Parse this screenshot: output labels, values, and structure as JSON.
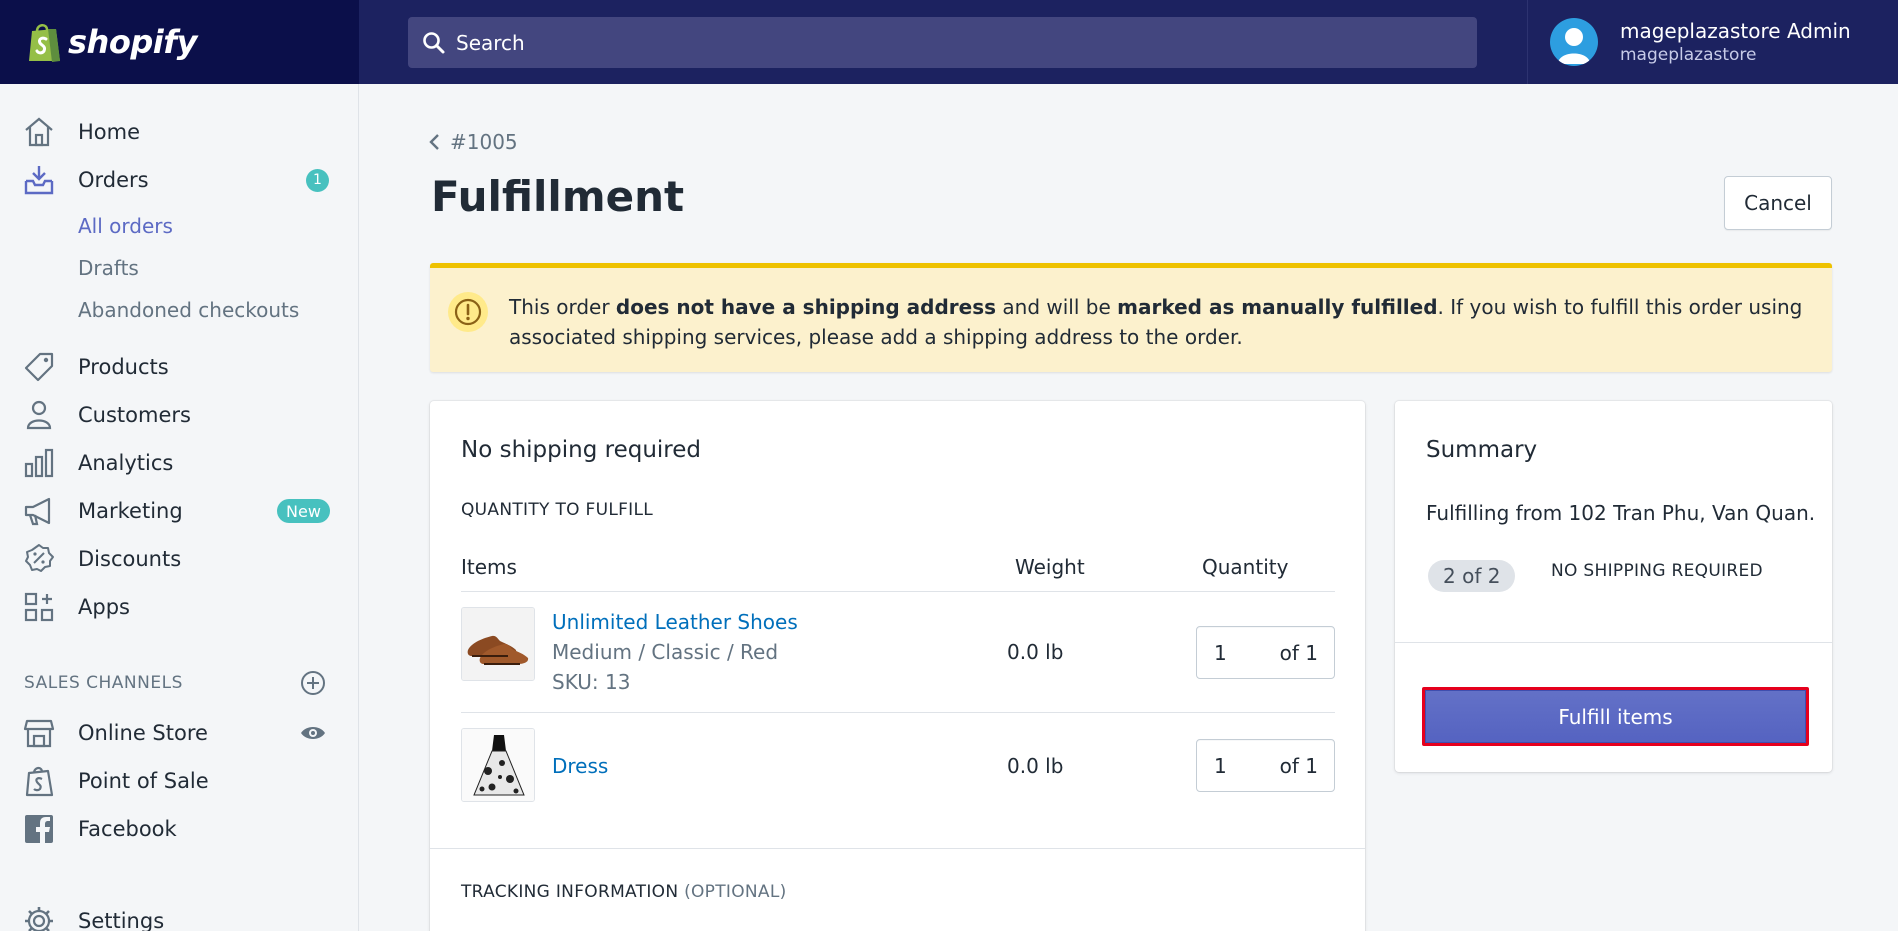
{
  "brand": {
    "name": "shopify"
  },
  "search": {
    "placeholder": "Search"
  },
  "user": {
    "name": "mageplazastore Admin",
    "store": "mageplazastore"
  },
  "sidebar": {
    "items": [
      {
        "label": "Home",
        "icon": "home-icon"
      },
      {
        "label": "Orders",
        "icon": "orders-icon",
        "badge": "1"
      },
      {
        "label": "Products",
        "icon": "tag-icon"
      },
      {
        "label": "Customers",
        "icon": "person-icon"
      },
      {
        "label": "Analytics",
        "icon": "bar-chart-icon"
      },
      {
        "label": "Marketing",
        "icon": "megaphone-icon",
        "badge": "New"
      },
      {
        "label": "Discounts",
        "icon": "discount-icon"
      },
      {
        "label": "Apps",
        "icon": "apps-icon"
      }
    ],
    "orders_sub": [
      "All orders",
      "Drafts",
      "Abandoned checkouts"
    ],
    "sales_channels_heading": "SALES CHANNELS",
    "channels": [
      {
        "label": "Online Store",
        "icon": "store-icon"
      },
      {
        "label": "Point of Sale",
        "icon": "pos-bag-icon"
      },
      {
        "label": "Facebook",
        "icon": "facebook-icon"
      }
    ],
    "settings": {
      "label": "Settings",
      "icon": "gear-icon"
    }
  },
  "page": {
    "back_label": "#1005",
    "title": "Fulfillment",
    "cancel_label": "Cancel"
  },
  "banner": {
    "t1": "This order ",
    "b1": "does not have a shipping address",
    "t2": " and will be ",
    "b2": "marked as manually fulfilled",
    "t3": ". If you wish to fulfill this order using associated shipping services, please add a shipping address to the order."
  },
  "fulfill_card": {
    "title": "No shipping required",
    "quantity_heading": "QUANTITY TO FULFILL",
    "columns": {
      "items": "Items",
      "weight": "Weight",
      "quantity": "Quantity"
    },
    "rows": [
      {
        "name": "Unlimited Leather Shoes",
        "variant": "Medium / Classic / Red",
        "sku": "SKU: 13",
        "weight": "0.0 lb",
        "qty": "1",
        "of": "of 1"
      },
      {
        "name": "Dress",
        "weight": "0.0 lb",
        "qty": "1",
        "of": "of 1"
      }
    ],
    "tracking_heading": "TRACKING INFORMATION",
    "tracking_optional": "(OPTIONAL)"
  },
  "summary": {
    "title": "Summary",
    "from_text": "Fulfilling from 102 Tran Phu, Van Quan.",
    "count_pill": "2 of 2",
    "status": "NO SHIPPING REQUIRED",
    "fulfill_label": "Fulfill items"
  },
  "colors": {
    "topbar": "#1c2260",
    "logo_bg": "#0b0f4a",
    "accent": "#5c6ac4",
    "badge": "#47c1bf",
    "link": "#006fbb",
    "banner_bg": "#fcf1cd",
    "banner_border": "#eec200",
    "highlight": "#e5001d"
  }
}
